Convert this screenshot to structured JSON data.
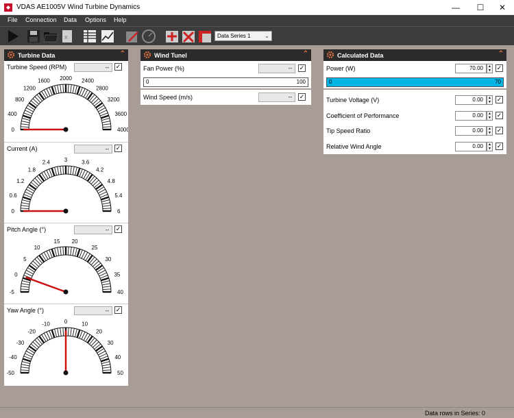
{
  "window": {
    "title": "VDAS AE1005V Wind Turbine Dynamics"
  },
  "menu": [
    "File",
    "Connection",
    "Data",
    "Options",
    "Help"
  ],
  "toolbar": {
    "series_selected": "Data Series 1"
  },
  "turbine_panel": {
    "title": "Turbine Data",
    "gauges": [
      {
        "label": "Turbine Speed  (RPM)",
        "value": "--",
        "ticks": [
          "0",
          "400",
          "800",
          "1200",
          "1600",
          "2000",
          "2400",
          "2800",
          "3200",
          "3600",
          "4000"
        ],
        "min": 0,
        "max": 4000,
        "needle": 0
      },
      {
        "label": "Current  (A)",
        "value": "--",
        "ticks": [
          "0",
          "0.6",
          "1.2",
          "1.8",
          "2.4",
          "3",
          "3.6",
          "4.2",
          "4.8",
          "5.4",
          "6"
        ],
        "min": 0,
        "max": 6,
        "needle": 0
      },
      {
        "label": "Pitch Angle  (°)",
        "value": "--",
        "ticks": [
          "-5",
          "0",
          "5",
          "10",
          "15",
          "20",
          "25",
          "30",
          "35",
          "40"
        ],
        "min": -5,
        "max": 40,
        "needle": 0
      },
      {
        "label": "Yaw Angle  (°)",
        "value": "--",
        "ticks": [
          "-50",
          "-40",
          "-30",
          "-20",
          "-10",
          "0",
          "10",
          "20",
          "30",
          "40",
          "50"
        ],
        "min": -50,
        "max": 50,
        "needle": 0
      }
    ]
  },
  "wind_panel": {
    "title": "Wind Tunel",
    "fan_power": {
      "label": "Fan Power  (%)",
      "value": "--",
      "bar_min": "0",
      "bar_max": "100",
      "level": 0
    },
    "wind_speed": {
      "label": "Wind Speed  (m/s)",
      "value": "--"
    }
  },
  "calc_panel": {
    "title": "Calculated Data",
    "power": {
      "label": "Power  (W)",
      "value": "70.00",
      "bar_min": "0",
      "bar_max": "70",
      "level": 1.0
    },
    "rows": [
      {
        "label": "Turbine Voltage  (V)",
        "value": "0.00"
      },
      {
        "label": "Coefficient of Performance",
        "value": "0.00"
      },
      {
        "label": "Tip Speed Ratio",
        "value": "0.00"
      },
      {
        "label": "Relative Wind Angle",
        "value": "0.00"
      }
    ]
  },
  "status": {
    "text": "Data rows in Series: 0"
  },
  "colors": {
    "accent_bar": "#00b4e6",
    "needle": "#cc1111",
    "header": "#2b2b2b",
    "menu_bg": "#3c3c3c"
  }
}
